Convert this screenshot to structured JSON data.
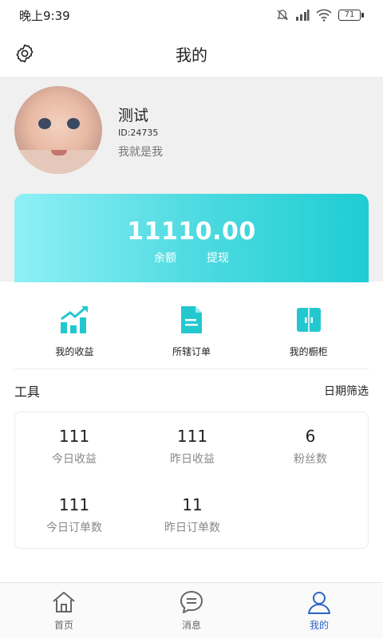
{
  "status_bar": {
    "time": "晚上9:39",
    "battery": "71"
  },
  "header": {
    "title": "我的",
    "settings_icon": "gear-icon"
  },
  "profile": {
    "name": "测试",
    "id": "ID:24735",
    "bio": "我就是我"
  },
  "balance": {
    "amount": "11110.00",
    "balance_label": "余额",
    "withdraw_label": "提现"
  },
  "menu": [
    {
      "label": "我的收益",
      "icon": "chart-growth-icon"
    },
    {
      "label": "所辖订单",
      "icon": "document-icon"
    },
    {
      "label": "我的橱柜",
      "icon": "cabinet-icon"
    }
  ],
  "tools": {
    "title": "工具",
    "filter": "日期筛选"
  },
  "stats": [
    {
      "value": "111",
      "label": "今日收益"
    },
    {
      "value": "111",
      "label": "昨日收益"
    },
    {
      "value": "6",
      "label": "粉丝数"
    },
    {
      "value": "111",
      "label": "今日订单数"
    },
    {
      "value": "11",
      "label": "昨日订单数"
    }
  ],
  "tabbar": [
    {
      "label": "首页",
      "icon": "home-icon"
    },
    {
      "label": "消息",
      "icon": "message-icon"
    },
    {
      "label": "我的",
      "icon": "user-icon"
    }
  ],
  "colors": {
    "accent": "#1ecdd3",
    "tab_active": "#2e63c6"
  }
}
